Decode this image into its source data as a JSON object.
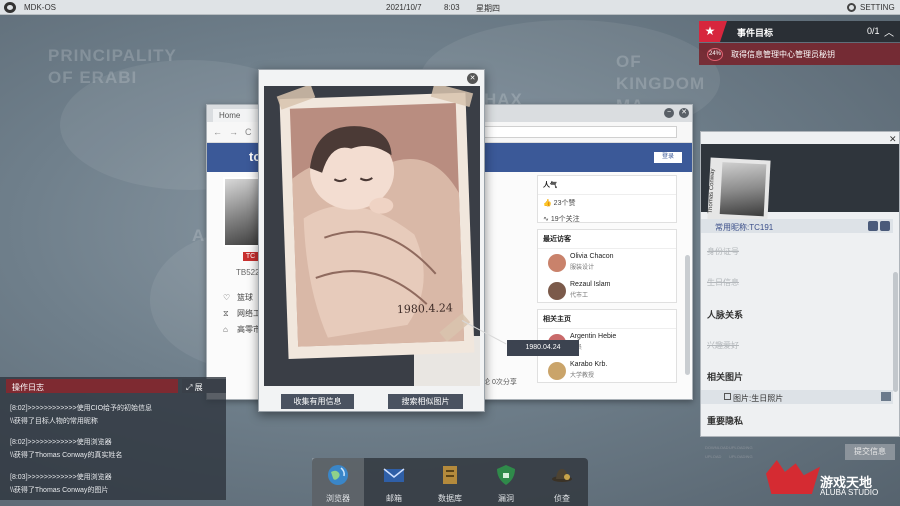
{
  "map": {
    "labels": [
      "PRINCIPALITY",
      "OF ERABI",
      "HAX",
      "KINGDOM",
      "OF",
      "MA",
      "AN"
    ]
  },
  "topbar": {
    "os_name": "MDK-OS",
    "date": "2021/10/7",
    "time": "8:03",
    "weekday": "星期四",
    "settings_label": "SETTING"
  },
  "objective": {
    "title": "事件目标",
    "count": "0/1",
    "progress": "24%",
    "task": "取得信息管理中心管理员秘钥"
  },
  "browser": {
    "tab_label": "Home",
    "brand": "to",
    "login_label": "登录",
    "tag": "TC",
    "user_id": "TB522",
    "info": [
      {
        "icon": "heart-icon",
        "text": "篮球"
      },
      {
        "icon": "tie-icon",
        "text": "网络工"
      },
      {
        "icon": "home-icon",
        "text": "高零市"
      }
    ],
    "stats_title": "人气",
    "stats": [
      "23个赞",
      "19个关注"
    ],
    "visitors_title": "最近访客",
    "visitors": [
      {
        "name": "Olivia Chacon",
        "role": "服装设计",
        "color": "#c9826b"
      },
      {
        "name": "Rezaul Islam",
        "role": "代市工",
        "color": "#7b5a4a"
      }
    ],
    "pages_title": "相关主页",
    "pages": [
      {
        "name": "Argentin Hebie",
        "role": "门员",
        "color": "#c96a6a"
      },
      {
        "name": "Karabo Krb.",
        "role": "大学教授",
        "color": "#caa46a"
      }
    ],
    "share_text": "论  0次分享"
  },
  "viewer": {
    "photo_caption": "1980.4.24",
    "btn_collect": "收集有用信息",
    "btn_search": "搜索相似图片",
    "tooltip": "1980.04.24"
  },
  "dossier": {
    "name_vertical": "Thomas Conway",
    "nickname": "常用昵称:TC191",
    "faded": [
      "身份证号",
      "生日信息",
      "兴趣爱好"
    ],
    "sections": [
      "人脉关系",
      "相关图片",
      "重要隐私"
    ],
    "photo_item": "图片:生日照片",
    "submit_label": "提交信息",
    "footer_tags": [
      "DOWNLOAD",
      "UPLOADING",
      "UPLOAD",
      "UPLOADING"
    ]
  },
  "log": {
    "title": "操作日志",
    "expand_label": "展",
    "lines": [
      "[8:02]>>>>>>>>>>>>使用CIO给予的初始信息",
      "\\\\获得了目标人物的常用昵称",
      "[8:02]>>>>>>>>>>>>使用浏览器",
      "\\\\获得了Thomas Conway的真实姓名",
      "[8:03]>>>>>>>>>>>>使用浏览器",
      "\\\\获得了Thomas Conway的图片"
    ]
  },
  "dock": {
    "items": [
      {
        "label": "浏览器",
        "icon": "globe-icon",
        "active": true
      },
      {
        "label": "邮箱",
        "icon": "mail-icon",
        "active": false
      },
      {
        "label": "数据库",
        "icon": "database-icon",
        "active": false
      },
      {
        "label": "漏洞",
        "icon": "shield-icon",
        "active": false
      },
      {
        "label": "侦查",
        "icon": "hat-icon",
        "active": false
      }
    ]
  },
  "watermark": {
    "text": "游戏天地",
    "sub": "ALUBA STUDIO"
  },
  "colors": {
    "accent_red": "#d7263d",
    "facebook_blue": "#3b5998",
    "panel_dark": "#2f353c"
  }
}
